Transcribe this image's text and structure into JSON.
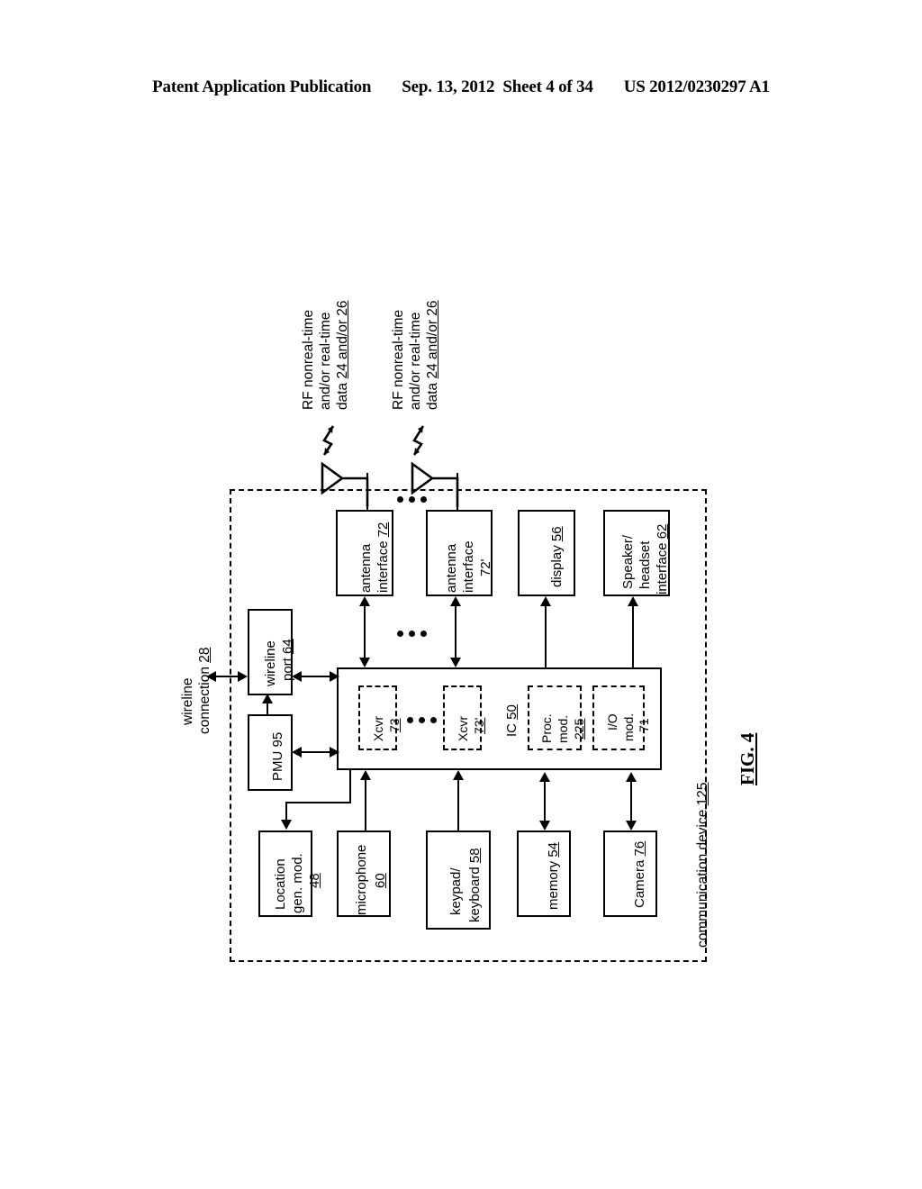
{
  "header": {
    "publication": "Patent Application Publication",
    "date": "Sep. 13, 2012",
    "sheet": "Sheet 4 of 34",
    "number": "US 2012/0230297 A1"
  },
  "figure": {
    "label": "FIG. 4",
    "device_label": "communication device 125",
    "device_ref": "125"
  },
  "signals": {
    "rf_1_line1": "RF nonreal-time",
    "rf_1_line2": "and/or real-time",
    "rf_1_line3": "data 24 and/or 26",
    "rf_2_line1": "RF nonreal-time",
    "rf_2_line2": "and/or real-time",
    "rf_2_line3": "data 24 and/or 26",
    "wireline_line1": "wireline",
    "wireline_line2": "connection 28"
  },
  "blocks": {
    "antenna_interface_72": {
      "line1": "antenna",
      "line2": "interface 72"
    },
    "antenna_interface_72p": {
      "line1": "antenna",
      "line2": "interface",
      "line3": "72'"
    },
    "display_56": {
      "line1": "display 56"
    },
    "speaker_headset_62": {
      "line1": "Speaker/",
      "line2": "headset",
      "line3": "interface 62"
    },
    "wireline_port_64": {
      "line1": "wireline",
      "line2": "port 64"
    },
    "pmu_95": {
      "line1": "PMU 95"
    },
    "location_gen_mod_48": {
      "line1": "Location",
      "line2": "gen. mod.",
      "line3": "48"
    },
    "microphone_60": {
      "line1": "microphone",
      "line2": "60"
    },
    "keypad_keyboard_58": {
      "line1": "keypad/",
      "line2": "keyboard 58"
    },
    "memory_54": {
      "line1": "memory 54"
    },
    "camera_76": {
      "line1": "Camera 76"
    }
  },
  "ic": {
    "label": "IC 50",
    "xcvr_73": {
      "line1": "Xcvr",
      "line2": "73"
    },
    "xcvr_73p": {
      "line1": "Xcvr",
      "line2": "73'"
    },
    "proc_mod_225": {
      "line1": "Proc.",
      "line2": "mod.",
      "line3": "225"
    },
    "io_mod_71": {
      "line1": "I/O",
      "line2": "mod.",
      "line3": "71"
    }
  }
}
